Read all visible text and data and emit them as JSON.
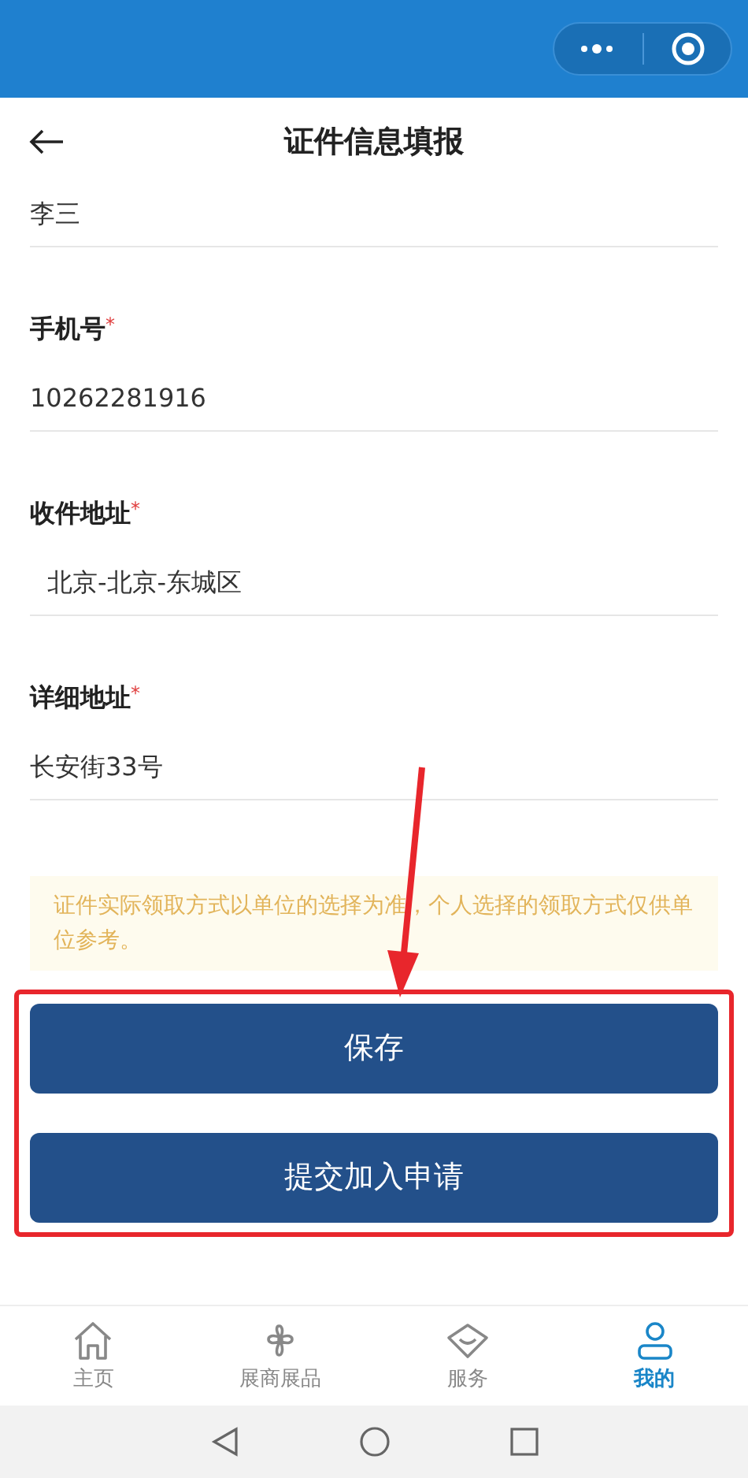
{
  "header": {
    "title": "证件信息填报"
  },
  "fields": [
    {
      "kind": "text",
      "value": "李三"
    },
    {
      "kind": "text",
      "label": "手机号",
      "required_mark": "*",
      "value": "10262281916"
    },
    {
      "kind": "picker",
      "label": "收件地址",
      "required_mark": "*",
      "value": "北京-北京-东城区"
    },
    {
      "kind": "text",
      "label": "详细地址",
      "required_mark": "*",
      "value": "长安街33号"
    }
  ],
  "notice": "证件实际领取方式以单位的选择为准，个人选择的领取方式仅供单位参考。",
  "buttons": [
    "保存",
    "提交加入申请"
  ],
  "tabs": [
    {
      "label": "主页",
      "selected": false
    },
    {
      "label": "展商展品",
      "selected": false
    },
    {
      "label": "服务",
      "selected": false
    },
    {
      "label": "我的",
      "selected": true
    }
  ]
}
